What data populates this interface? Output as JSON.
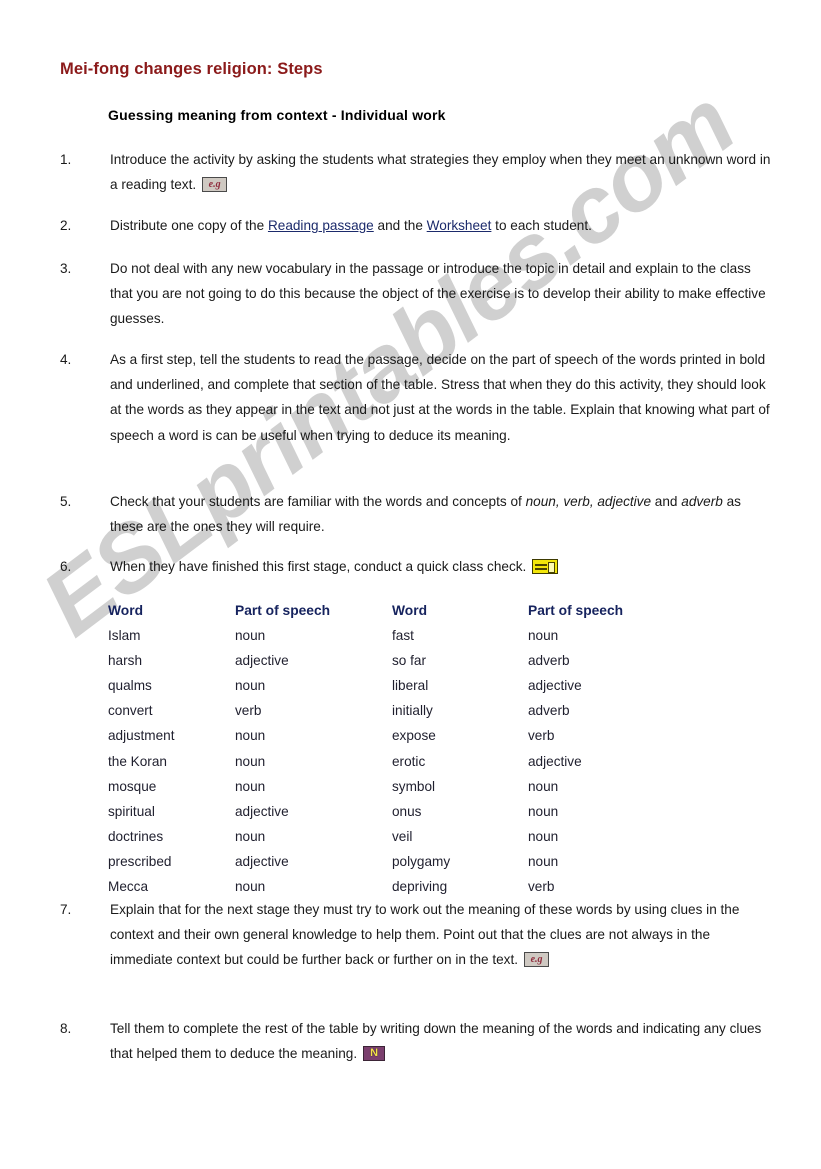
{
  "document": {
    "title": "Mei-fong changes religion: Steps",
    "subtitle": "Guessing meaning from context - Individual work",
    "title_color": "#8b1a1a",
    "link_color": "#1b2a6b",
    "table_header_color": "#16235e"
  },
  "watermark": {
    "text": "ESLprintables.com",
    "color": "#c8c8c8"
  },
  "steps": [
    {
      "number": "1.",
      "segments": [
        {
          "type": "text",
          "text": "Introduce the activity by asking the students what strategies they employ when they meet an unknown word in a reading text."
        },
        {
          "type": "icon",
          "icon": "eg-icon",
          "label": "e.g"
        }
      ]
    },
    {
      "number": "2.",
      "segments": [
        {
          "type": "text",
          "text": "Distribute one copy of the "
        },
        {
          "type": "link",
          "text": "Reading passage"
        },
        {
          "type": "text",
          "text": " and the "
        },
        {
          "type": "link",
          "text": "Worksheet"
        },
        {
          "type": "text",
          "text": " to each student."
        }
      ]
    },
    {
      "number": "3.",
      "segments": [
        {
          "type": "text",
          "text": "Do not deal with any new vocabulary in the passage or introduce the topic in detail and explain to the class that you are not going to do this because the object of the exercise is to develop their ability to make effective guesses."
        }
      ]
    },
    {
      "number": "4.",
      "segments": [
        {
          "type": "text",
          "text": "As a first step, tell the students to read the passage, decide on the part of speech of the words printed in bold and underlined, and complete that section of the table. Stress that when they do this activity, they should look at the words as they appear in the text and not just at the words in the table. Explain that knowing what part of speech a word is can be useful when trying to deduce its meaning."
        }
      ]
    },
    {
      "number": "5.",
      "segments": [
        {
          "type": "text",
          "text": "Check that your students are familiar with the words and concepts of "
        },
        {
          "type": "italic",
          "text": "noun, verb, adjective"
        },
        {
          "type": "text",
          "text": " and "
        },
        {
          "type": "italic",
          "text": "adverb"
        },
        {
          "type": "text",
          "text": " as these are the ones they will require."
        }
      ]
    },
    {
      "number": "6.",
      "segments": [
        {
          "type": "text",
          "text": "When they have finished this first stage, conduct a quick class check."
        },
        {
          "type": "icon",
          "icon": "yellow-bar-icon",
          "label": ""
        }
      ]
    },
    {
      "number": "7.",
      "segments": [
        {
          "type": "text",
          "text": "Explain that for the next stage they must try to work out the meaning of these words by using clues in the context and their own general knowledge to help them. Point out that the clues are not always in the immediate context but could be further back or further on in the text."
        },
        {
          "type": "icon",
          "icon": "eg-icon",
          "label": "e.g"
        }
      ]
    },
    {
      "number": "8.",
      "segments": [
        {
          "type": "text",
          "text": "Tell them to complete the rest of the table by writing down the meaning of the words and indicating any clues that helped them to deduce the meaning."
        },
        {
          "type": "icon",
          "icon": "n-icon",
          "label": "N"
        }
      ]
    }
  ],
  "word_table": {
    "headers": [
      "Word",
      "Part of speech",
      "Word",
      "Part of speech"
    ],
    "rows": [
      [
        "Islam",
        "noun",
        "fast",
        "noun"
      ],
      [
        "harsh",
        "adjective",
        "so far",
        "adverb"
      ],
      [
        "qualms",
        "noun",
        "liberal",
        "adjective"
      ],
      [
        "convert",
        "verb",
        "initially",
        "adverb"
      ],
      [
        "adjustment",
        "noun",
        "expose",
        "verb"
      ],
      [
        "the Koran",
        "noun",
        "erotic",
        "adjective"
      ],
      [
        "mosque",
        "noun",
        "symbol",
        "noun"
      ],
      [
        "spiritual",
        "adjective",
        "onus",
        "noun"
      ],
      [
        "doctrines",
        "noun",
        "veil",
        "noun"
      ],
      [
        "prescribed",
        "adjective",
        "polygamy",
        "noun"
      ],
      [
        "Mecca",
        "noun",
        "depriving",
        "verb"
      ]
    ]
  }
}
